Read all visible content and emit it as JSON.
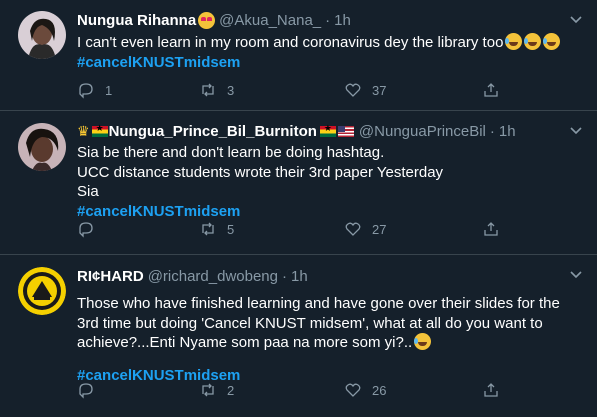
{
  "tweets": [
    {
      "name": "Nungua Rihanna",
      "handle": "@Akua_Nana_",
      "time": "1h",
      "text": "I can't even learn in my room and coronavirus dey the library too",
      "hashtag": "#cancelKNUSTmidsem",
      "replies": "1",
      "retweets": "3",
      "likes": "37"
    },
    {
      "name": "Nungua_Prince_Bil_Burniton",
      "handle": "@NunguaPrinceBil",
      "time": "1h",
      "lines": [
        "Sia be there and don't learn be doing hashtag.",
        "UCC distance students wrote their 3rd paper Yesterday",
        "Sia"
      ],
      "hashtag": "#cancelKNUSTmidsem",
      "replies": "",
      "retweets": "5",
      "likes": "27"
    },
    {
      "name": "RI¢HARD",
      "handle": "@richard_dwobeng",
      "time": "1h",
      "text": "Those who have finished learning and have gone over their slides for the 3rd time but doing 'Cancel KNUST midsem', what at all do you want to achieve?...Enti Nyame som paa na more som yi?..",
      "hashtag": "#cancelKNUSTmidsem",
      "replies": "",
      "retweets": "2",
      "likes": "26"
    }
  ],
  "colors": {
    "background": "#15202b",
    "divider": "#38444d",
    "secondary_text": "#8899a6",
    "hashtag": "#1da1f2"
  },
  "icons": [
    "reply-icon",
    "retweet-icon",
    "like-icon",
    "share-icon",
    "chevron-down-icon",
    "heart-eyes-emoji",
    "tears-of-joy-emoji",
    "crown-emoji",
    "ghana-flag",
    "us-flag"
  ]
}
